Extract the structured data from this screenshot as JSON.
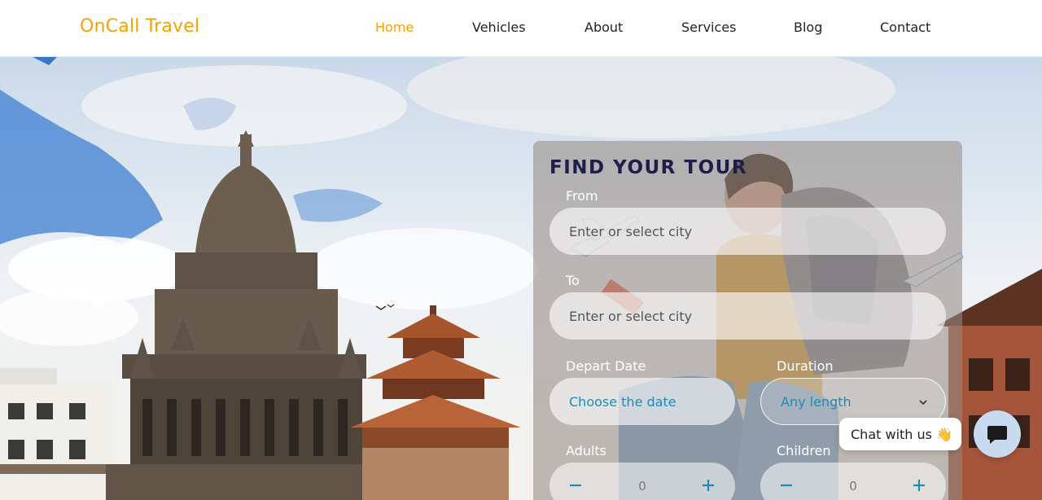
{
  "brand": {
    "name": "OnCall Travel",
    "color": "#f5a100"
  },
  "nav": {
    "items": [
      {
        "label": "Home",
        "active": true
      },
      {
        "label": "Vehicles",
        "active": false
      },
      {
        "label": "About",
        "active": false
      },
      {
        "label": "Services",
        "active": false
      },
      {
        "label": "Blog",
        "active": false
      },
      {
        "label": "Contact",
        "active": false
      }
    ]
  },
  "tour_form": {
    "title": "FIND YOUR TOUR",
    "from": {
      "label": "From",
      "placeholder": "Enter or select city"
    },
    "to": {
      "label": "To",
      "placeholder": "Enter or select city"
    },
    "depart": {
      "label": "Depart Date",
      "placeholder": "Choose the date"
    },
    "duration": {
      "label": "Duration",
      "selected": "Any length"
    },
    "adults": {
      "label": "Adults",
      "value": "0"
    },
    "children": {
      "label": "Children",
      "value": "0"
    }
  },
  "chat": {
    "label": "Chat with us 👋"
  },
  "icons": {
    "minus": "minus-icon",
    "plus": "plus-icon",
    "chevron": "chevron-down-icon",
    "chat": "chat-icon",
    "plane": "airplane-icon"
  }
}
